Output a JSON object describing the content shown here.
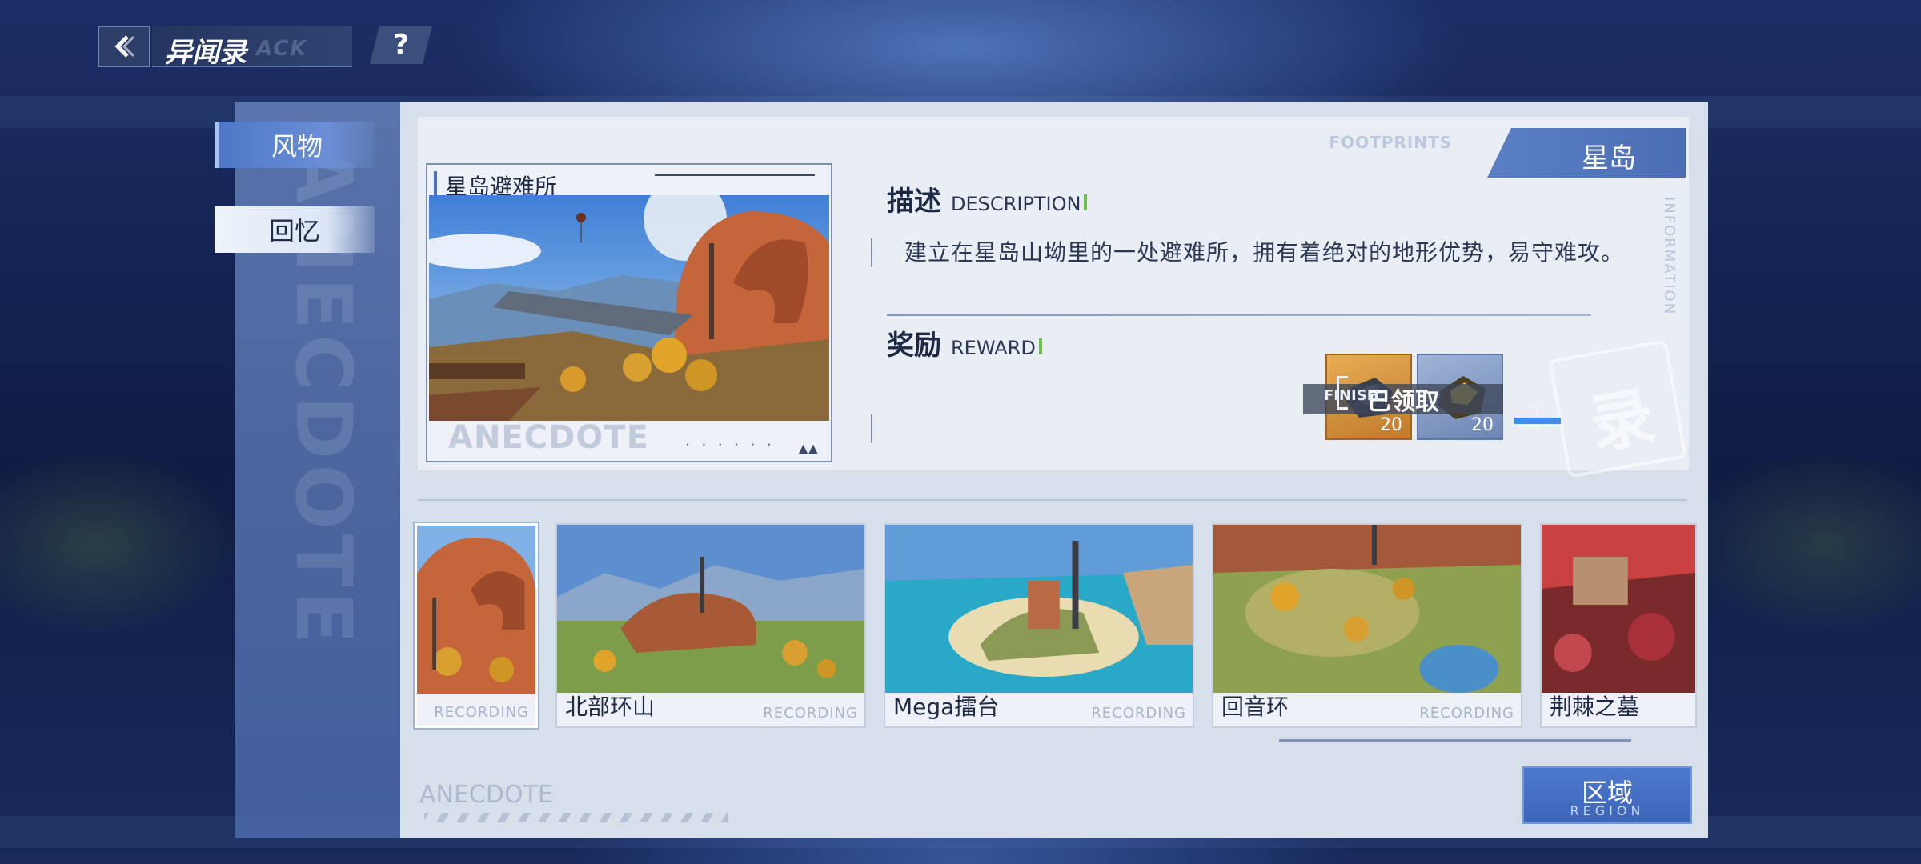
{
  "header": {
    "title": "异闻录",
    "title_ghost": "ACK",
    "help_label": "?"
  },
  "sidebar": {
    "ghost_text": "ANECDOTE",
    "items": [
      {
        "label": "风物",
        "active": true
      },
      {
        "label": "回忆",
        "active": false
      }
    ]
  },
  "card": {
    "footprints": "FOOTPRINTS",
    "region_tag": "星岛",
    "side_info": "INFORMATION",
    "preview_title": "星岛避难所",
    "preview_watermark": "ANECDOTE",
    "description_cn": "描述",
    "description_en": "DESCRIPTION",
    "description_text": "建立在星岛山坳里的一处避难所，拥有着绝对的地形优势，易守难攻。",
    "reward_cn": "奖励",
    "reward_en": "REWARD",
    "rewards": [
      {
        "icon": "ore-gold-icon",
        "count": "20"
      },
      {
        "icon": "ore-blue-icon",
        "count": "20"
      }
    ],
    "claimed_label": "已领取",
    "finish_label": "FINISH",
    "seal_glyph": "录"
  },
  "thumbnails": [
    {
      "label": "",
      "recording": "RECORDING",
      "selected": true
    },
    {
      "label": "北部环山",
      "recording": "RECORDING",
      "selected": false
    },
    {
      "label": "Mega擂台",
      "recording": "RECORDING",
      "selected": false
    },
    {
      "label": "回音环",
      "recording": "RECORDING",
      "selected": false
    },
    {
      "label": "荆棘之墓",
      "recording": "",
      "selected": false
    }
  ],
  "footer": {
    "watermark": "ANECDOTE",
    "region_button_cn": "区域",
    "region_button_en": "REGION"
  }
}
